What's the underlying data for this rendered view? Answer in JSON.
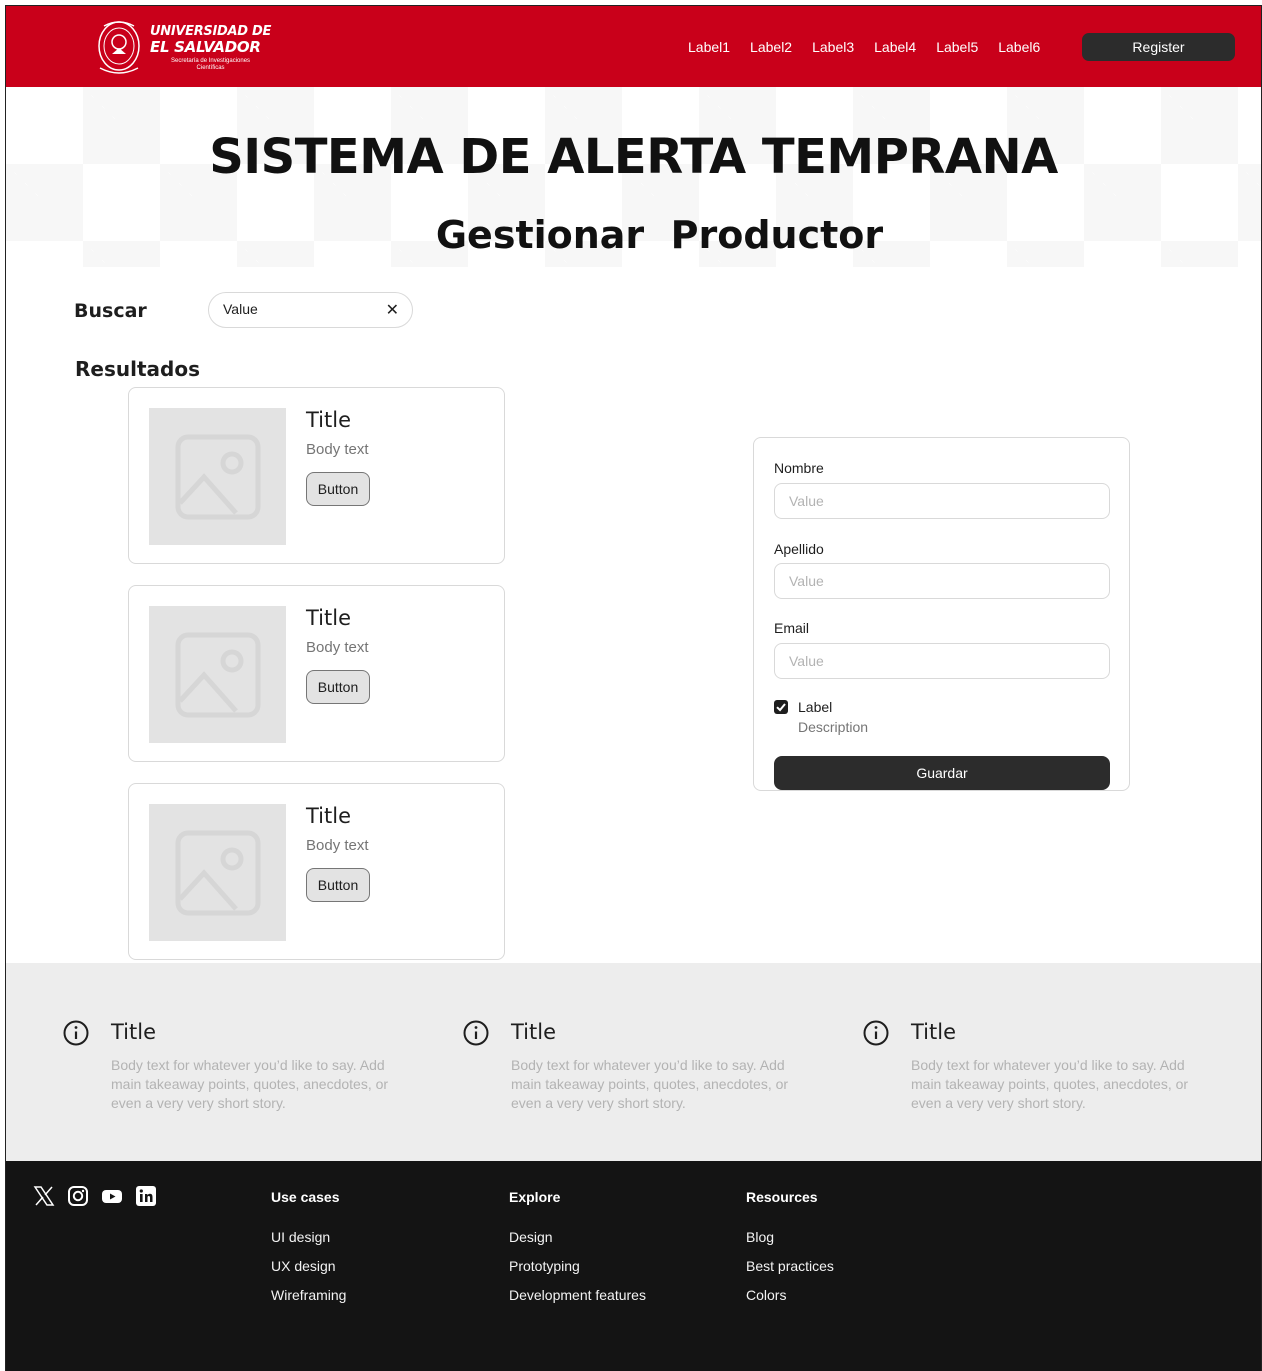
{
  "header": {
    "logo": {
      "line1": "UNIVERSIDAD DE",
      "line2": "EL SALVADOR",
      "line3": "Secretaría de Investigaciones",
      "line4": "Científicas"
    },
    "nav": [
      "Label1",
      "Label2",
      "Label3",
      "Label4",
      "Label5",
      "Label6"
    ],
    "register_label": "Register",
    "brand_color": "#c9001a"
  },
  "hero": {
    "title": "SISTEMA DE ALERTA TEMPRANA",
    "subtitle": "Gestionar  Productor"
  },
  "search": {
    "label": "Buscar",
    "value": "Value",
    "clear_icon": "close-icon"
  },
  "results": {
    "heading": "Resultados",
    "cards": [
      {
        "title": "Title",
        "body": "Body text",
        "button": "Button",
        "image_icon": "image-placeholder-icon"
      },
      {
        "title": "Title",
        "body": "Body text",
        "button": "Button",
        "image_icon": "image-placeholder-icon"
      },
      {
        "title": "Title",
        "body": "Body text",
        "button": "Button",
        "image_icon": "image-placeholder-icon"
      }
    ]
  },
  "form": {
    "fields": [
      {
        "label": "Nombre",
        "placeholder": "Value"
      },
      {
        "label": "Apellido",
        "placeholder": "Value"
      },
      {
        "label": "Email",
        "placeholder": "Value"
      }
    ],
    "checkbox": {
      "label": "Label",
      "description": "Description",
      "checked": true
    },
    "submit_label": "Guardar"
  },
  "features": [
    {
      "icon": "info-icon",
      "title": "Title",
      "body": "Body text for whatever you’d like to say. Add main takeaway points, quotes, anecdotes, or even a very very short story."
    },
    {
      "icon": "info-icon",
      "title": "Title",
      "body": "Body text for whatever you’d like to say. Add main takeaway points, quotes, anecdotes, or even a very very short story."
    },
    {
      "icon": "info-icon",
      "title": "Title",
      "body": "Body text for whatever you’d like to say. Add main takeaway points, quotes, anecdotes, or even a very very short story."
    }
  ],
  "footer": {
    "socials": [
      "x-icon",
      "instagram-icon",
      "youtube-icon",
      "linkedin-icon"
    ],
    "columns": [
      {
        "heading": "Use cases",
        "links": [
          "UI design",
          "UX design",
          "Wireframing"
        ]
      },
      {
        "heading": "Explore",
        "links": [
          "Design",
          "Prototyping",
          "Development features"
        ]
      },
      {
        "heading": "Resources",
        "links": [
          "Blog",
          "Best practices",
          "Colors"
        ]
      }
    ]
  }
}
